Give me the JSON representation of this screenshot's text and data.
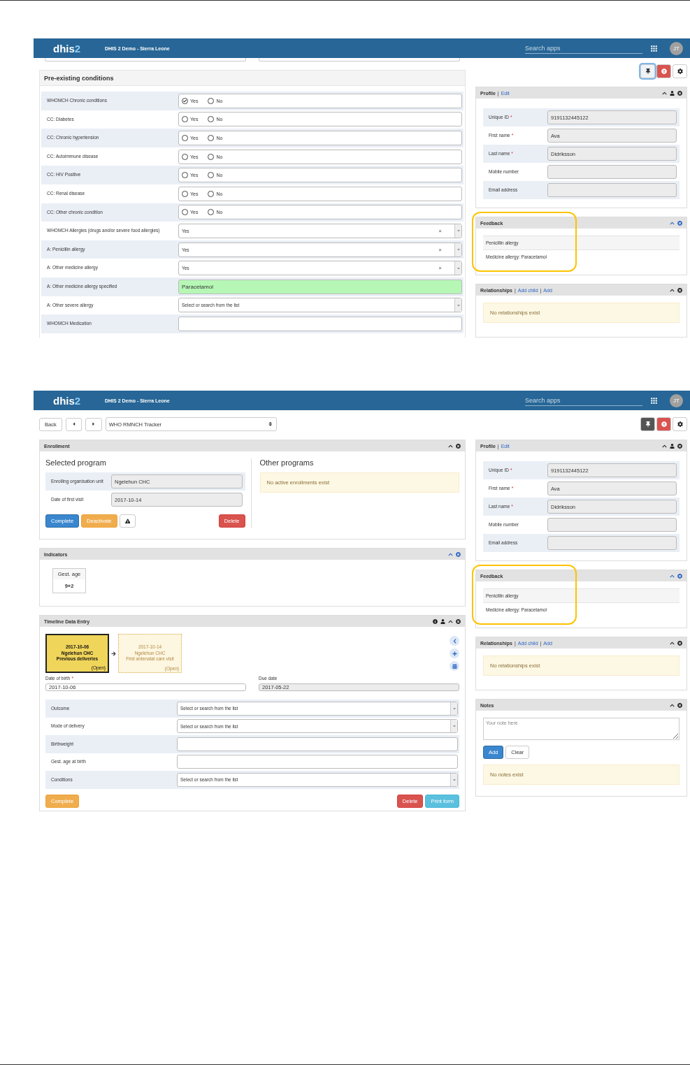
{
  "screenshot_1": {
    "header": {
      "logo": "dhis",
      "logo_accent": "2",
      "instance": "DHIS 2 Demo - Sierra Leone",
      "search_placeholder": "Search apps",
      "avatar": "JT"
    },
    "toolbar": {
      "pin_pressed": false
    },
    "section": {
      "title": "Pre-existing conditions",
      "rows": [
        {
          "label": "WHOMCH Chronic conditions",
          "kind": "radio",
          "options": [
            {
              "label": "Yes",
              "selected": true
            },
            {
              "label": "No",
              "selected": false
            }
          ]
        },
        {
          "label": "CC: Diabetes",
          "kind": "radio",
          "options": [
            {
              "label": "Yes",
              "selected": false
            },
            {
              "label": "No",
              "selected": false
            }
          ]
        },
        {
          "label": "CC: Chronic hypertension",
          "kind": "radio",
          "options": [
            {
              "label": "Yes",
              "selected": false
            },
            {
              "label": "No",
              "selected": false
            }
          ]
        },
        {
          "label": "CC: Autoimmune disease",
          "kind": "radio",
          "options": [
            {
              "label": "Yes",
              "selected": false
            },
            {
              "label": "No",
              "selected": false
            }
          ]
        },
        {
          "label": "CC: HIV Positive",
          "kind": "radio",
          "options": [
            {
              "label": "Yes",
              "selected": false
            },
            {
              "label": "No",
              "selected": false
            }
          ]
        },
        {
          "label": "CC: Renal disease",
          "kind": "radio",
          "options": [
            {
              "label": "Yes",
              "selected": false
            },
            {
              "label": "No",
              "selected": false
            }
          ]
        },
        {
          "label": "CC: Other chronic condition",
          "kind": "radio",
          "options": [
            {
              "label": "Yes",
              "selected": false
            },
            {
              "label": "No",
              "selected": false
            }
          ]
        },
        {
          "label": "WHOMCH Allergies (drugs and/or severe food allergies)",
          "kind": "select",
          "value": "Yes",
          "clear": "×"
        },
        {
          "label": "A: Penicillin allergy",
          "kind": "select",
          "value": "Yes",
          "clear": "×"
        },
        {
          "label": "A: Other medicine allergy",
          "kind": "select",
          "value": "Yes",
          "clear": "×"
        },
        {
          "label": "A: Other medicine allergy specified",
          "kind": "text",
          "value": "Paracetamol",
          "highlighted": true
        },
        {
          "label": "A: Other severe allergy",
          "kind": "select",
          "value": "Select or search from the list"
        },
        {
          "label": "WHOMCH Medication",
          "kind": "text",
          "highlighted": false
        }
      ]
    },
    "profile": {
      "title": "Profile",
      "separator": "|",
      "link": "Edit",
      "fields": [
        {
          "label": "Unique ID",
          "mark": "*",
          "value": "9191132445122"
        },
        {
          "label": "First name",
          "mark": "*",
          "value": "Ava"
        },
        {
          "label": "Last name",
          "mark": "*",
          "value": "Didriksson"
        },
        {
          "label": "Mobile number"
        },
        {
          "label": "Email address"
        }
      ]
    },
    "feedback": {
      "title": "Feedback",
      "items": [
        "Penicillin allergy",
        "Medicine allergy: Paracetamol"
      ]
    },
    "relationships": {
      "title": "Relationships",
      "separator": "|",
      "links": [
        "Add child",
        "Add"
      ],
      "message": "No relationships exist"
    }
  },
  "screenshot_2": {
    "header": {
      "logo": "dhis",
      "logo_accent": "2",
      "instance": "DHIS 2 Demo - Sierra Leone",
      "search_placeholder": "Search apps",
      "avatar": "JT"
    },
    "nav": {
      "back": "Back",
      "program": "WHO RMNCH Tracker"
    },
    "toolbar": {
      "pin_pressed": true
    },
    "enrollment": {
      "title": "Enrollment",
      "selected_heading": "Selected program",
      "fields": [
        {
          "label": "Enrolling organisation unit",
          "value": "Ngelehun CHC"
        },
        {
          "label": "Date of first visit",
          "value": "2017-10-14"
        }
      ],
      "buttons": [
        {
          "label": "Complete",
          "kind": "primary"
        },
        {
          "label": "Deactivate",
          "kind": "warning"
        },
        {
          "kind": "alert"
        },
        {
          "label": "Delete",
          "kind": "danger"
        }
      ],
      "other_heading": "Other programs",
      "other_message": "No active enrollments exist"
    },
    "indicators": {
      "title": "Indicators",
      "items": [
        {
          "label": "Gest. age",
          "value": "9+2"
        }
      ]
    },
    "timeline": {
      "title": "Timeline Data Entry",
      "events": [
        {
          "date": "2017-10-06",
          "org_unit": "Ngelehun CHC",
          "stage": "Previous deliveries",
          "status": "(Open)",
          "selected": true
        },
        {
          "date": "2017-10-14",
          "org_unit": "Ngelehun CHC",
          "stage": "First antenatal care visit",
          "status": "(Open)",
          "selected": false
        }
      ],
      "date_fields": [
        {
          "label": "Date of birth",
          "mark": "*",
          "value": "2017-10-06",
          "disabled": false
        },
        {
          "label": "Due date",
          "value": "2017-05-22",
          "disabled": true
        }
      ],
      "rows": [
        {
          "label": "Outcome",
          "kind": "select",
          "value": "Select or search from the list"
        },
        {
          "label": "Mode of delivery",
          "kind": "select",
          "value": "Select or search from the list"
        },
        {
          "label": "Birthweight",
          "kind": "text",
          "highlighted": false
        },
        {
          "label": "Gest. age at birth",
          "kind": "text",
          "highlighted": false
        },
        {
          "label": "Conditions",
          "kind": "select",
          "value": "Select or search from the list"
        }
      ],
      "buttons": [
        {
          "label": "Complete",
          "kind": "warning"
        },
        {
          "label": "Delete",
          "kind": "danger"
        },
        {
          "label": "Print form",
          "kind": "info"
        }
      ]
    },
    "profile": {
      "title": "Profile",
      "separator": "|",
      "link": "Edit",
      "fields": [
        {
          "label": "Unique ID",
          "mark": "*",
          "value": "9191132445122"
        },
        {
          "label": "First name",
          "mark": "*",
          "value": "Ava"
        },
        {
          "label": "Last name",
          "mark": "*",
          "value": "Didriksson"
        },
        {
          "label": "Mobile number"
        },
        {
          "label": "Email address"
        }
      ]
    },
    "feedback": {
      "title": "Feedback",
      "items": [
        "Penicillin allergy",
        "Medicine allergy: Paracetamol"
      ]
    },
    "relationships": {
      "title": "Relationships",
      "separator": "|",
      "links": [
        "Add child",
        "Add"
      ],
      "message": "No relationships exist"
    },
    "notes": {
      "title": "Notes",
      "placeholder": "Your note here",
      "buttons": [
        {
          "label": "Add",
          "kind": "primary"
        },
        {
          "label": "Clear",
          "kind": "default"
        }
      ],
      "message": "No notes exist"
    }
  }
}
